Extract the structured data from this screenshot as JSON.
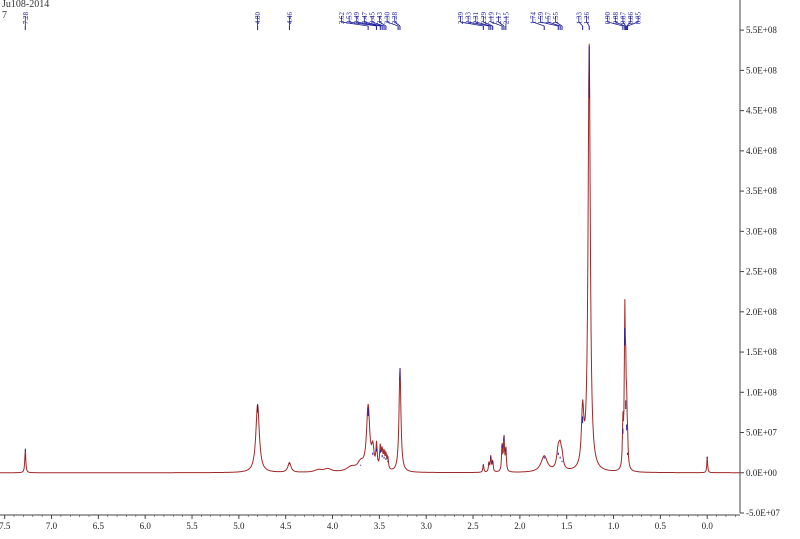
{
  "header": {
    "line1": "Ju108-2014",
    "line2": "7"
  },
  "chart_data": {
    "type": "line",
    "xlabel": "",
    "ylabel": "",
    "xlim": [
      7.55,
      -0.35
    ],
    "ylim": [
      -50000000,
      580000000
    ],
    "x_ticks": [
      {
        "v": 7.5,
        "t": "7.5"
      },
      {
        "v": 7.0,
        "t": "7.0"
      },
      {
        "v": 6.5,
        "t": "6.5"
      },
      {
        "v": 6.0,
        "t": "6.0"
      },
      {
        "v": 5.5,
        "t": "5.5"
      },
      {
        "v": 5.0,
        "t": "5.0"
      },
      {
        "v": 4.5,
        "t": "4.5"
      },
      {
        "v": 4.0,
        "t": "4.0"
      },
      {
        "v": 3.5,
        "t": "3.5"
      },
      {
        "v": 3.0,
        "t": "3.0"
      },
      {
        "v": 2.5,
        "t": "2.5"
      },
      {
        "v": 2.0,
        "t": "2.0"
      },
      {
        "v": 1.5,
        "t": "1.5"
      },
      {
        "v": 1.0,
        "t": "1.0"
      },
      {
        "v": 0.5,
        "t": "0.5"
      },
      {
        "v": 0.0,
        "t": "0.0"
      }
    ],
    "y_ticks": [
      {
        "v": 550000000,
        "t": "5.5E+08"
      },
      {
        "v": 500000000,
        "t": "5.0E+08"
      },
      {
        "v": 450000000,
        "t": "4.5E+08"
      },
      {
        "v": 400000000,
        "t": "4.0E+08"
      },
      {
        "v": 350000000,
        "t": "3.5E+08"
      },
      {
        "v": 300000000,
        "t": "3.0E+08"
      },
      {
        "v": 250000000,
        "t": "2.5E+08"
      },
      {
        "v": 200000000,
        "t": "2.0E+08"
      },
      {
        "v": 150000000,
        "t": "1.5E+08"
      },
      {
        "v": 100000000,
        "t": "1.0E+08"
      },
      {
        "v": 50000000,
        "t": "5.0E+07"
      },
      {
        "v": 0,
        "t": "0.0E+00"
      },
      {
        "v": -50000000,
        "t": "-5.0E+07"
      }
    ],
    "peaks": [
      {
        "ppm": 7.28,
        "h": 30000000,
        "w": 0.006
      },
      {
        "ppm": 4.8,
        "h": 85000000,
        "w": 0.022
      },
      {
        "ppm": 4.46,
        "h": 12000000,
        "w": 0.02
      },
      {
        "ppm": 4.15,
        "h": 3000000,
        "w": 0.05
      },
      {
        "ppm": 4.05,
        "h": 4000000,
        "w": 0.05
      },
      {
        "ppm": 3.8,
        "h": 6000000,
        "w": 0.06
      },
      {
        "ppm": 3.7,
        "h": 10000000,
        "w": 0.04
      },
      {
        "ppm": 3.62,
        "h": 80000000,
        "w": 0.02
      },
      {
        "ppm": 3.57,
        "h": 25000000,
        "w": 0.015
      },
      {
        "ppm": 3.53,
        "h": 30000000,
        "w": 0.008
      },
      {
        "ppm": 3.49,
        "h": 28000000,
        "w": 0.008
      },
      {
        "ppm": 3.47,
        "h": 22000000,
        "w": 0.008
      },
      {
        "ppm": 3.45,
        "h": 20000000,
        "w": 0.008
      },
      {
        "ppm": 3.43,
        "h": 18000000,
        "w": 0.008
      },
      {
        "ppm": 3.41,
        "h": 15000000,
        "w": 0.008
      },
      {
        "ppm": 3.28,
        "h": 130000000,
        "w": 0.012
      },
      {
        "ppm": 2.39,
        "h": 10000000,
        "w": 0.006
      },
      {
        "ppm": 2.33,
        "h": 12000000,
        "w": 0.006
      },
      {
        "ppm": 2.31,
        "h": 20000000,
        "w": 0.006
      },
      {
        "ppm": 2.29,
        "h": 14000000,
        "w": 0.006
      },
      {
        "ppm": 2.19,
        "h": 35000000,
        "w": 0.006
      },
      {
        "ppm": 2.17,
        "h": 45000000,
        "w": 0.006
      },
      {
        "ppm": 2.15,
        "h": 30000000,
        "w": 0.006
      },
      {
        "ppm": 1.74,
        "h": 20000000,
        "w": 0.04
      },
      {
        "ppm": 1.59,
        "h": 25000000,
        "w": 0.02
      },
      {
        "ppm": 1.57,
        "h": 20000000,
        "w": 0.015
      },
      {
        "ppm": 1.55,
        "h": 15000000,
        "w": 0.015
      },
      {
        "ppm": 1.33,
        "h": 70000000,
        "w": 0.015
      },
      {
        "ppm": 1.26,
        "h": 530000000,
        "w": 0.014
      },
      {
        "ppm": 0.9,
        "h": 55000000,
        "w": 0.006
      },
      {
        "ppm": 0.88,
        "h": 180000000,
        "w": 0.006
      },
      {
        "ppm": 0.87,
        "h": 90000000,
        "w": 0.006
      },
      {
        "ppm": 0.86,
        "h": 60000000,
        "w": 0.006
      },
      {
        "ppm": 0.85,
        "h": 25000000,
        "w": 0.006
      },
      {
        "ppm": 0.0,
        "h": 20000000,
        "w": 0.005
      }
    ],
    "peak_label_groups": [
      {
        "labels": [
          "7.28"
        ],
        "start": 7.28,
        "anchors": [
          7.28
        ]
      },
      {
        "labels": [
          "4.80"
        ],
        "start": 4.8,
        "anchors": [
          4.8
        ]
      },
      {
        "labels": [
          "4.46"
        ],
        "start": 4.46,
        "anchors": [
          4.46
        ]
      },
      {
        "labels": [
          "3.62",
          "3.53",
          "3.49",
          "3.47",
          "3.45",
          "3.43",
          "3.30",
          "3.28"
        ],
        "start": 3.62,
        "anchors": [
          3.62,
          3.53,
          3.49,
          3.47,
          3.45,
          3.43,
          3.3,
          3.28
        ]
      },
      {
        "labels": [
          "2.39",
          "2.33",
          "2.31",
          "2.29",
          "2.19",
          "2.17",
          "2.15"
        ],
        "start": 2.39,
        "anchors": [
          2.39,
          2.33,
          2.31,
          2.29,
          2.19,
          2.17,
          2.15
        ]
      },
      {
        "labels": [
          "1.74",
          "1.59",
          "1.57",
          "1.55"
        ],
        "start": 1.74,
        "anchors": [
          1.74,
          1.59,
          1.57,
          1.55
        ]
      },
      {
        "labels": [
          "1.33",
          "1.26"
        ],
        "start": 1.33,
        "anchors": [
          1.33,
          1.26
        ]
      },
      {
        "labels": [
          "0.90",
          "0.88",
          "0.87",
          "0.86",
          "0.85"
        ],
        "start": 0.9,
        "anchors": [
          0.9,
          0.88,
          0.87,
          0.86,
          0.85
        ]
      }
    ],
    "colors": {
      "spectrum": "#a02828",
      "labels": "#1a1a99",
      "axis": "#444444"
    }
  }
}
